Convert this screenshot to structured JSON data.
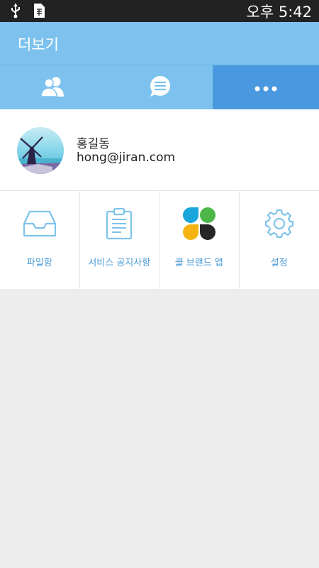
{
  "status_bar": {
    "time": "오후 5:42",
    "icons": [
      "usb-icon",
      "sim-icon"
    ]
  },
  "app_bar": {
    "title": "더보기"
  },
  "tabs": [
    {
      "icon": "contacts-icon",
      "active": false
    },
    {
      "icon": "chat-icon",
      "active": false
    },
    {
      "icon": "more-icon",
      "active": true
    }
  ],
  "profile": {
    "name": "홍길동",
    "email": "hong@jiran.com"
  },
  "menu": [
    {
      "label": "파일함",
      "icon": "inbox-icon"
    },
    {
      "label": "서비스 공지사항",
      "icon": "clipboard-icon"
    },
    {
      "label": "쿨 브랜드 앱",
      "icon": "brand-apps-icon"
    },
    {
      "label": "설정",
      "icon": "gear-icon"
    }
  ],
  "colors": {
    "primary": "#7dc2ee",
    "tab_active": "#4a98df",
    "accent_text": "#4a9bd6",
    "background": "#ededed"
  }
}
